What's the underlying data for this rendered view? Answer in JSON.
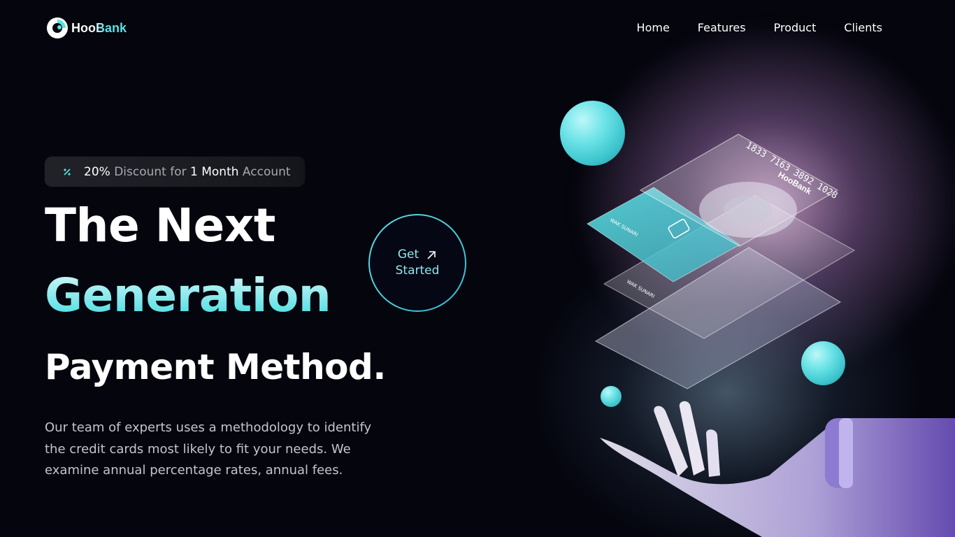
{
  "brand": {
    "name": "HooBank",
    "accent": "#5ce1e6"
  },
  "nav": {
    "items": [
      "Home",
      "Features",
      "Product",
      "Clients"
    ]
  },
  "discount": {
    "percent": "20%",
    "mid": " Discount for ",
    "duration": "1 Month",
    "tail": " Account"
  },
  "hero": {
    "line1": "The Next",
    "line2": "Generation",
    "line3": "Payment Method.",
    "description": "Our team of experts uses a methodology to identify the credit cards most likely to fit your needs. We examine annual percentage rates, annual fees."
  },
  "cta": {
    "line1": "Get",
    "line2": "Started"
  },
  "card": {
    "number": "1833 7163 3892 1028",
    "brand": "HooBank",
    "holder": "WAK SUNARI"
  },
  "icons": [
    "hoobank-logo-icon",
    "discount-icon",
    "arrow-up-right-icon",
    "robot-hand-image"
  ]
}
